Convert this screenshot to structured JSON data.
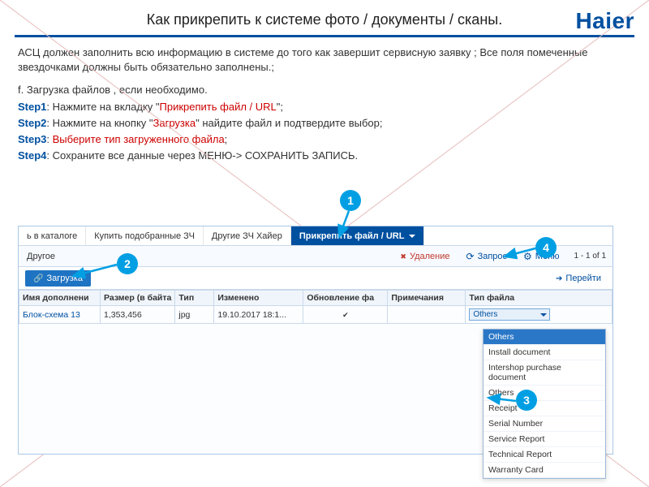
{
  "title": "Как прикрепить к системе фото / документы / сканы.",
  "brand": "Haier",
  "intro1": "АСЦ должен заполнить всю информацию в системе до того как завершит сервисную заявку ; Все поля помеченные звездочками должны быть обязательно заполнены.;",
  "intro2": "f. Загрузка файлов , если необходимо.",
  "steps": {
    "s1": {
      "label": "Step1",
      "pre": ": Нажмите на вкладку \"",
      "hl": "Прикрепить файл / URL",
      "post": "\";"
    },
    "s2": {
      "label": "Step2",
      "pre": ": Нажмите на кнопку \"",
      "hl": "Загрузка",
      "post": "\" найдите файл и подтвердите выбор;"
    },
    "s3": {
      "label": "Step3",
      "pre": ": ",
      "hl": "Выберите тип загруженного файла",
      "post": ";"
    },
    "s4": {
      "label": "Step4",
      "text": ": Сохраните все данные через  МЕНЮ-> СОХРАНИТЬ ЗАПИСЬ."
    }
  },
  "callouts": {
    "c1": "1",
    "c2": "2",
    "c3": "3",
    "c4": "4"
  },
  "tabs": {
    "t1": "ь в каталоге",
    "t2": "Купить подобранные ЗЧ",
    "t3": "Другие ЗЧ Хайер",
    "active": "Прикрепить файл / URL"
  },
  "toolbar": {
    "other": "Другое",
    "delete": "Удаление",
    "query": "Запрос",
    "menu": "Меню",
    "pager": "1 - 1 of 1"
  },
  "subbar": {
    "upload": "Загрузка",
    "goto": "Перейти"
  },
  "grid": {
    "h1": "Имя дополнени",
    "h2": "Размер (в байта",
    "h3": "Тип",
    "h4": "Изменено",
    "h5": "Обновление фа",
    "h6": "Примечания",
    "h7": "Тип файла",
    "r1c1": "Блок-схема 13",
    "r1c2": "1,353,456",
    "r1c3": "jpg",
    "r1c4": "19.10.2017 18:1...",
    "r1select": "Others"
  },
  "dropdown": {
    "o1": "Others",
    "o2": "Install document",
    "o3": "Intershop purchase document",
    "o4": "Others",
    "o5": "Receipt",
    "o6": "Serial Number",
    "o7": "Service Report",
    "o8": "Technical Report",
    "o9": "Warranty Card"
  }
}
